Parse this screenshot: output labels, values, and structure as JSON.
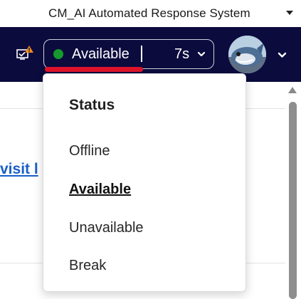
{
  "window": {
    "title": "CM_AI Automated Response System"
  },
  "navbar": {
    "alert_icon": "monitor-alert-icon",
    "status": {
      "label": "Available",
      "timer": "7s",
      "dot_color": "#169a2e"
    },
    "accent_underline_color": "#e0142a",
    "background": "#0c0b3e"
  },
  "content": {
    "link_text": "visit l"
  },
  "status_menu": {
    "heading": "Status",
    "options": [
      {
        "label": "Offline",
        "selected": false
      },
      {
        "label": "Available",
        "selected": true
      },
      {
        "label": "Unavailable",
        "selected": false
      },
      {
        "label": "Break",
        "selected": false
      }
    ]
  }
}
